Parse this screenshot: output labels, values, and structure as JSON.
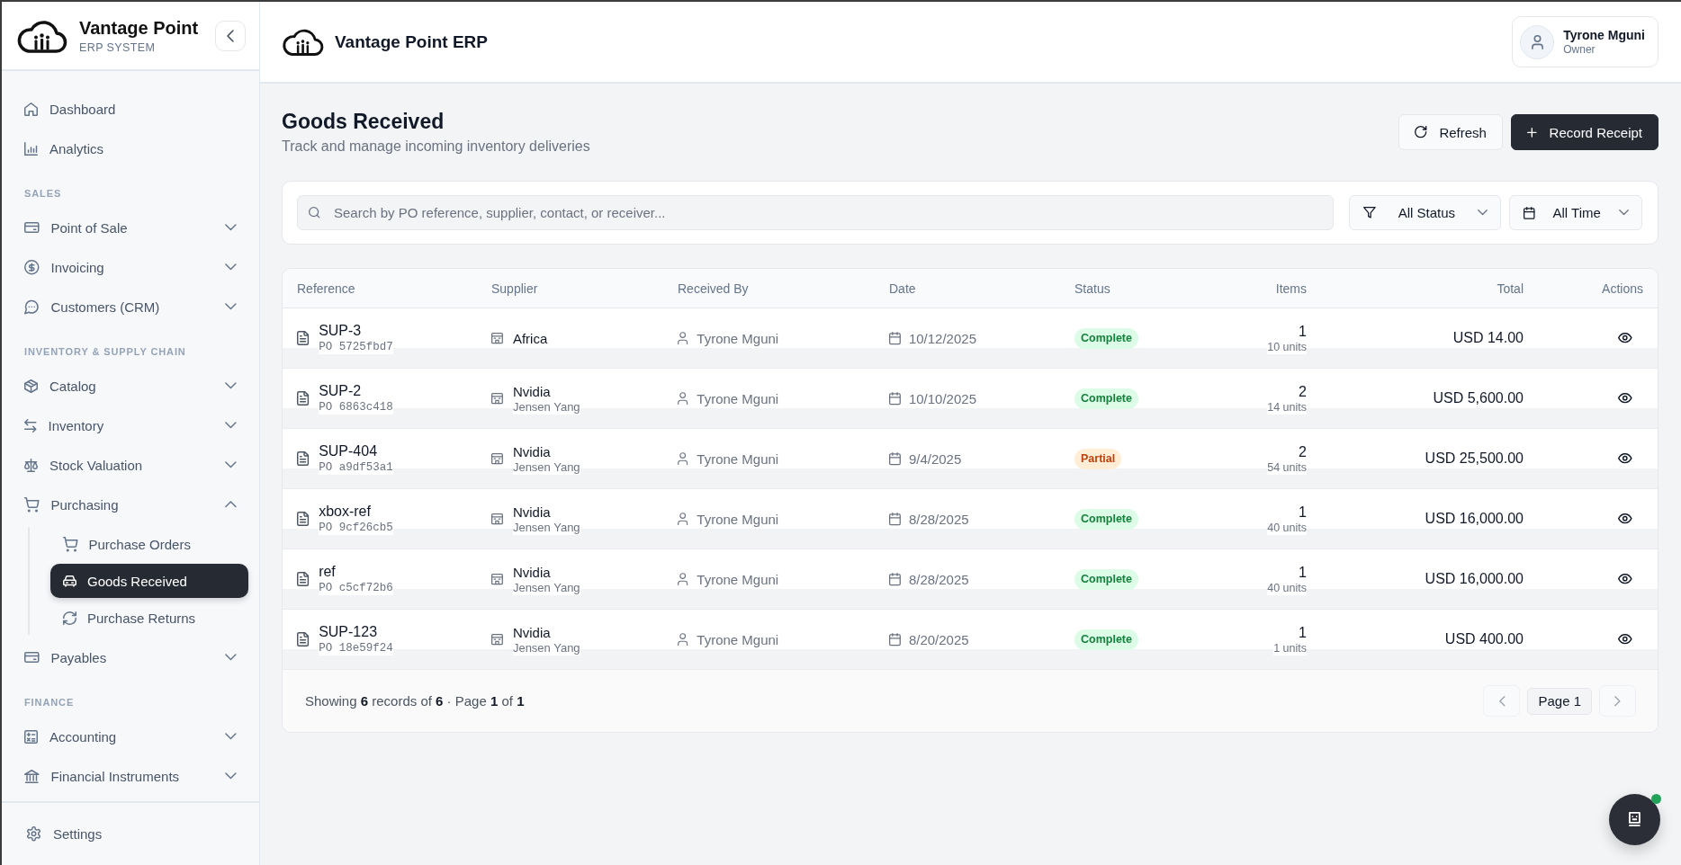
{
  "sidebar": {
    "brand": {
      "name": "Vantage Point",
      "subtitle": "ERP SYSTEM"
    },
    "sections": [
      {
        "items": [
          {
            "label": "Dashboard",
            "selected": false
          },
          {
            "label": "Analytics",
            "selected": false
          }
        ]
      },
      {
        "heading": "SALES",
        "items": [
          {
            "label": "Point of Sale",
            "selected": false,
            "expanded": false
          },
          {
            "label": "Invoicing",
            "selected": false,
            "expanded": false
          },
          {
            "label": "Customers (CRM)",
            "selected": false,
            "expanded": false
          }
        ]
      },
      {
        "heading": "INVENTORY & SUPPLY CHAIN",
        "items": [
          {
            "label": "Catalog",
            "selected": false,
            "expanded": false
          },
          {
            "label": "Inventory",
            "selected": false,
            "expanded": false
          },
          {
            "label": "Stock Valuation",
            "selected": false,
            "expanded": false
          },
          {
            "label": "Purchasing",
            "selected": false,
            "expanded": true,
            "children": [
              {
                "label": "Purchase Orders",
                "selected": false
              },
              {
                "label": "Goods Received",
                "selected": true
              },
              {
                "label": "Purchase Returns",
                "selected": false
              }
            ]
          },
          {
            "label": "Payables",
            "selected": false,
            "expanded": false
          }
        ]
      },
      {
        "heading": "FINANCE",
        "items": [
          {
            "label": "Accounting",
            "selected": false,
            "expanded": false
          },
          {
            "label": "Financial Instruments",
            "selected": false,
            "expanded": false
          }
        ]
      }
    ],
    "footer": {
      "label": "Settings"
    }
  },
  "header": {
    "title": "Vantage Point ERP",
    "user": {
      "name": "Tyrone Mguni",
      "role": "Owner"
    }
  },
  "page": {
    "title": "Goods Received",
    "subtitle": "Track and manage incoming inventory deliveries",
    "actions": [
      {
        "label": "Refresh",
        "kind": "secondary"
      },
      {
        "label": "Record Receipt",
        "kind": "primary"
      }
    ]
  },
  "filters": {
    "search": {
      "placeholder": "Search by PO reference, supplier, contact, or receiver..."
    },
    "dropdowns": [
      {
        "value": "All Status"
      },
      {
        "value": "All Time"
      }
    ]
  },
  "table": {
    "columns": [
      {
        "label": "Reference"
      },
      {
        "label": "Supplier"
      },
      {
        "label": "Received By"
      },
      {
        "label": "Date"
      },
      {
        "label": "Status"
      },
      {
        "label": "Items"
      },
      {
        "label": "Total"
      },
      {
        "label": "Actions"
      }
    ],
    "rows": [
      {
        "reference": "SUP-3",
        "po": "PO 5725fbd7",
        "supplier": "Africa",
        "received_by": "Tyrone Mguni",
        "date": "10/12/2025",
        "status": {
          "label": "Complete",
          "kind": "complete"
        },
        "items": "1",
        "units": "10 units",
        "total": "USD 14.00"
      },
      {
        "reference": "SUP-2",
        "po": "PO 6863c418",
        "supplier": "Nvidia",
        "contact": "Jensen Yang",
        "received_by": "Tyrone Mguni",
        "date": "10/10/2025",
        "status": {
          "label": "Complete",
          "kind": "complete"
        },
        "items": "2",
        "units": "14 units",
        "total": "USD 5,600.00"
      },
      {
        "reference": "SUP-404",
        "po": "PO a9df53a1",
        "supplier": "Nvidia",
        "contact": "Jensen Yang",
        "received_by": "Tyrone Mguni",
        "date": "9/4/2025",
        "status": {
          "label": "Partial",
          "kind": "partial"
        },
        "items": "2",
        "units": "54 units",
        "total": "USD 25,500.00"
      },
      {
        "reference": "xbox-ref",
        "po": "PO 9cf26cb5",
        "supplier": "Nvidia",
        "contact": "Jensen Yang",
        "received_by": "Tyrone Mguni",
        "date": "8/28/2025",
        "status": {
          "label": "Complete",
          "kind": "complete"
        },
        "items": "1",
        "units": "40 units",
        "total": "USD 16,000.00"
      },
      {
        "reference": "ref",
        "po": "PO c5cf72b6",
        "supplier": "Nvidia",
        "contact": "Jensen Yang",
        "received_by": "Tyrone Mguni",
        "date": "8/28/2025",
        "status": {
          "label": "Complete",
          "kind": "complete"
        },
        "items": "1",
        "units": "40 units",
        "total": "USD 16,000.00"
      },
      {
        "reference": "SUP-123",
        "po": "PO 18e59f24",
        "supplier": "Nvidia",
        "contact": "Jensen Yang",
        "received_by": "Tyrone Mguni",
        "date": "8/20/2025",
        "status": {
          "label": "Complete",
          "kind": "complete"
        },
        "items": "1",
        "units": "1 units",
        "total": "USD 400.00"
      }
    ],
    "footer": {
      "summary": "Showing **6** records of **6** · Page **1** of **1**",
      "pagination": {
        "prev_disabled": true,
        "page": "Page 1",
        "next_disabled": true
      }
    }
  },
  "assistant": {
    "online": true
  }
}
